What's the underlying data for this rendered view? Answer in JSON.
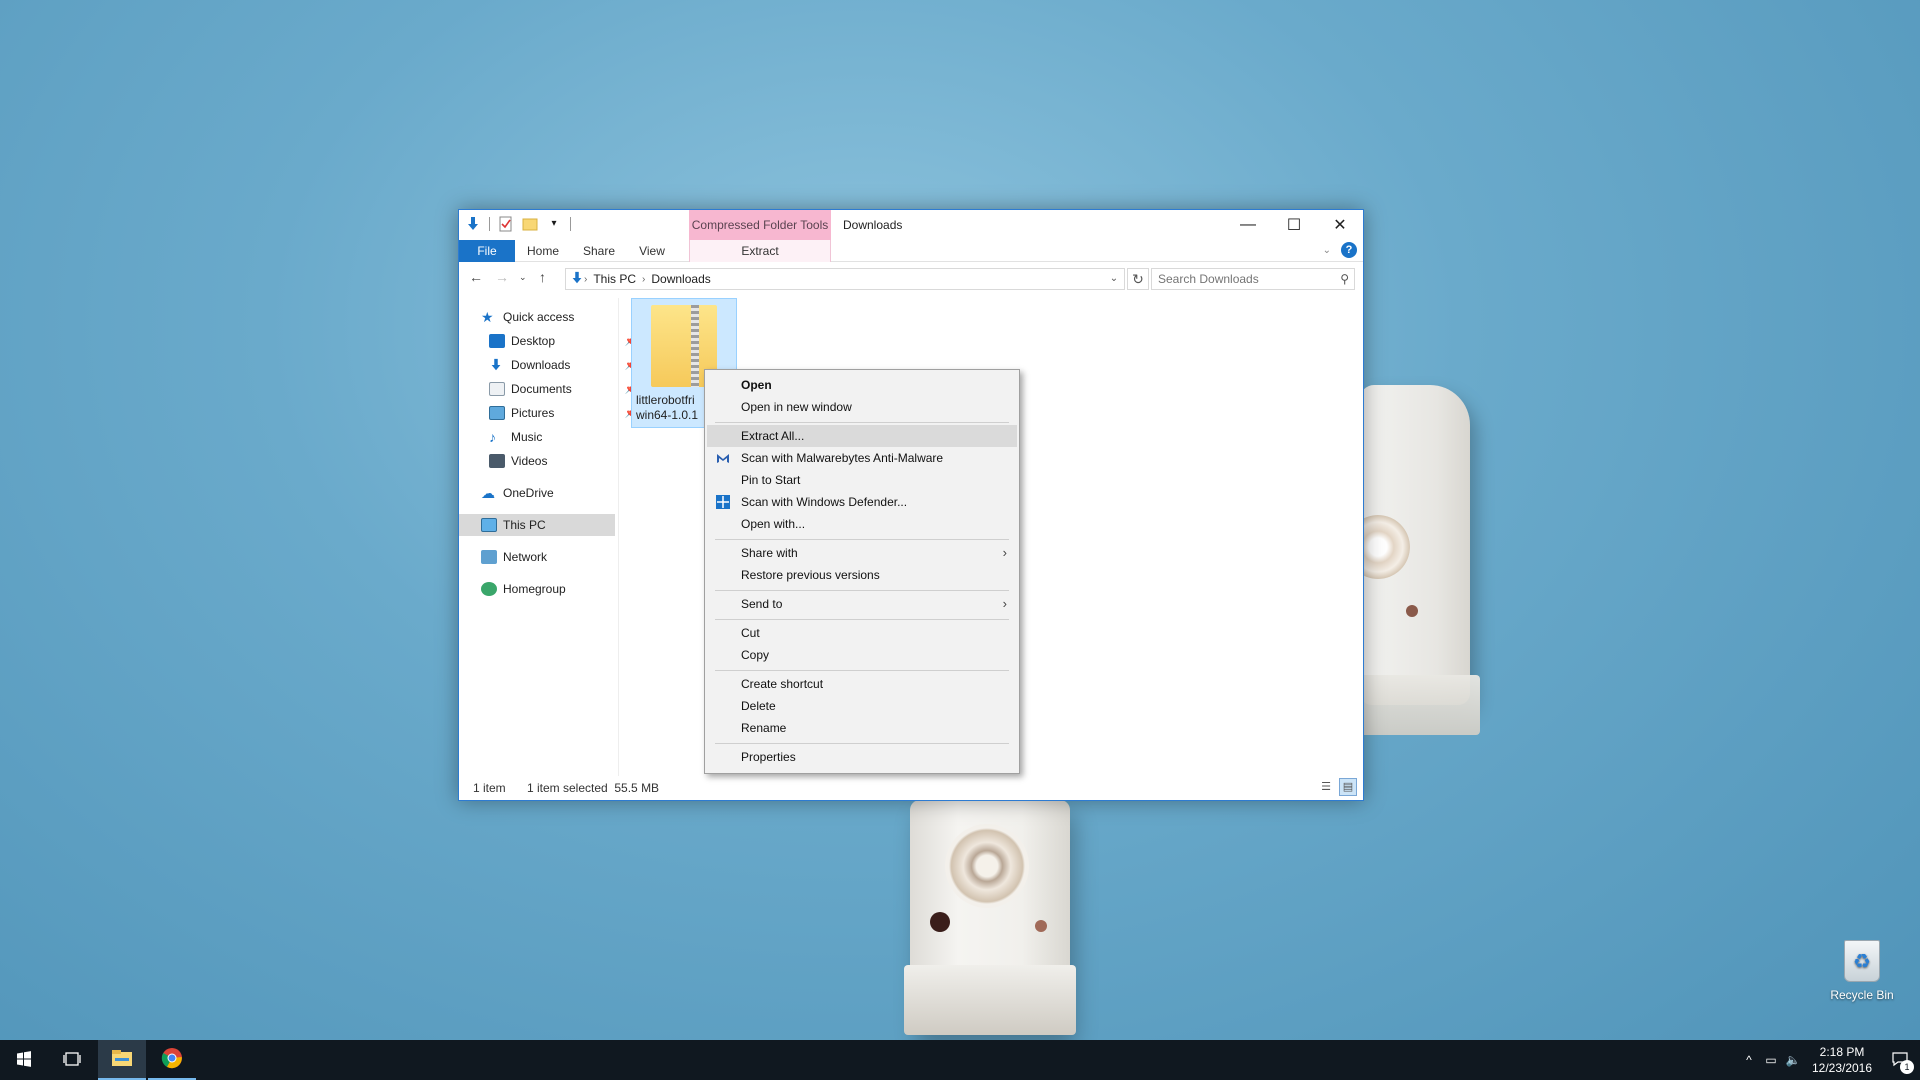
{
  "window": {
    "title": "Downloads",
    "context_tab_header": "Compressed Folder Tools",
    "controls": {
      "minimize": "—",
      "maximize": "☐",
      "close": "✕"
    }
  },
  "ribbon": {
    "tabs": [
      "File",
      "Home",
      "Share",
      "View",
      "Extract"
    ],
    "help": "?"
  },
  "address": {
    "crumbs": [
      "This PC",
      "Downloads"
    ],
    "search_placeholder": "Search Downloads"
  },
  "nav": {
    "items": [
      {
        "label": "Quick access"
      },
      {
        "label": "Desktop"
      },
      {
        "label": "Downloads"
      },
      {
        "label": "Documents"
      },
      {
        "label": "Pictures"
      },
      {
        "label": "Music"
      },
      {
        "label": "Videos"
      },
      {
        "label": "OneDrive"
      },
      {
        "label": "This PC"
      },
      {
        "label": "Network"
      },
      {
        "label": "Homegroup"
      }
    ]
  },
  "file": {
    "name_line1": "littlerobotfri",
    "name_line2": "win64-1.0.1"
  },
  "status": {
    "count": "1 item",
    "selected": "1 item selected  55.5 MB"
  },
  "context_menu": {
    "items": [
      "Open",
      "Open in new window",
      "Extract All...",
      "Scan with Malwarebytes Anti-Malware",
      "Pin to Start",
      "Scan with Windows Defender...",
      "Open with...",
      "Share with",
      "Restore previous versions",
      "Send to",
      "Cut",
      "Copy",
      "Create shortcut",
      "Delete",
      "Rename",
      "Properties"
    ]
  },
  "desktop": {
    "recycle_bin": "Recycle Bin"
  },
  "taskbar": {
    "time": "2:18 PM",
    "date": "12/23/2016",
    "notifications": "1"
  },
  "colors": {
    "accent": "#1a73c8",
    "context_tab": "#f7b7d0",
    "selection": "#cce8ff",
    "taskbar": "#101820"
  }
}
